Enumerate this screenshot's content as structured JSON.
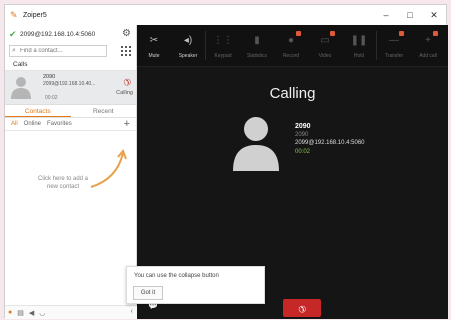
{
  "window": {
    "title": "Zoiper5",
    "controls": {
      "minimize": "–",
      "maximize": "□",
      "close": "✕"
    }
  },
  "account": {
    "address": "2099@192.168.10.4:5060",
    "status_icon": "check-icon"
  },
  "search": {
    "placeholder": "Find a contact..."
  },
  "calls": {
    "header": "Calls",
    "items": [
      {
        "name": "2090",
        "address": "2099@192.168.10.40...",
        "time": "00:02",
        "status": "Calling"
      }
    ]
  },
  "tabs": [
    {
      "label": "Contacts",
      "active": true
    },
    {
      "label": "Recent",
      "active": false
    }
  ],
  "subtabs": [
    {
      "label": "All",
      "active": true
    },
    {
      "label": "Online",
      "active": false
    },
    {
      "label": "Favorites",
      "active": false
    }
  ],
  "empty_hint": "Click here to add a new contact",
  "toolbar": [
    {
      "label": "Mute",
      "icon": "mic-off-icon",
      "enabled": true,
      "badge": false
    },
    {
      "label": "Speaker",
      "icon": "speaker-icon",
      "enabled": true,
      "badge": false
    },
    {
      "label": "Keypad",
      "icon": "keypad-icon",
      "enabled": false,
      "badge": false
    },
    {
      "label": "Statistics",
      "icon": "stats-icon",
      "enabled": false,
      "badge": false
    },
    {
      "label": "Record",
      "icon": "record-icon",
      "enabled": false,
      "badge": true
    },
    {
      "label": "Video",
      "icon": "video-icon",
      "enabled": false,
      "badge": true
    },
    {
      "label": "Hold",
      "icon": "pause-icon",
      "enabled": false,
      "badge": false
    },
    {
      "label": "Transfer",
      "icon": "transfer-icon",
      "enabled": false,
      "badge": true
    },
    {
      "label": "Add call",
      "icon": "add-call-icon",
      "enabled": false,
      "badge": true
    }
  ],
  "call": {
    "title": "Calling",
    "name": "2090",
    "number": "2090",
    "address": "2099@192.168.10.4:5060",
    "timer": "00:02"
  },
  "tooltip": {
    "text": "You can use the collapse button",
    "button": "Got it"
  },
  "colors": {
    "accent": "#e07a1b",
    "hangup": "#c62828",
    "timer": "#8bc34a",
    "call_bg": "#151515"
  }
}
